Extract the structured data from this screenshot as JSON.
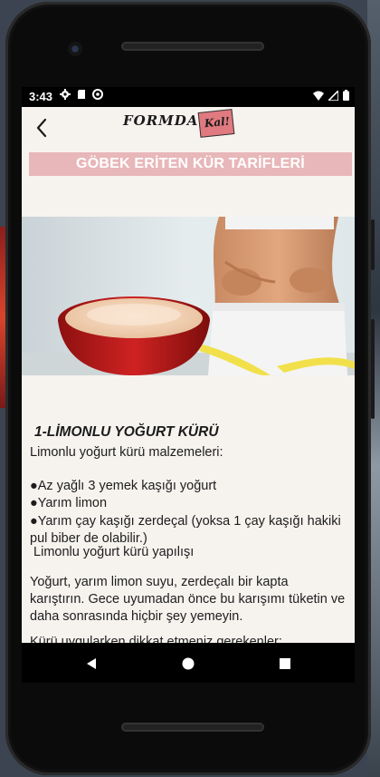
{
  "status_bar": {
    "time": "3:43",
    "left_icons": [
      "settings-icon",
      "sd-card-icon",
      "data-saver-icon"
    ],
    "right_icons": [
      "wifi-icon",
      "signal-icon",
      "battery-icon"
    ]
  },
  "app_bar": {
    "back_icon": "chevron-left-icon",
    "logo_text_main": "FORMDA",
    "logo_text_badge": "Kal!"
  },
  "page": {
    "title": "GÖBEK ERİTEN KÜR TARİFLERİ",
    "hero_image": "yogurt-bowl-and-waist-measuring-tape-image",
    "section_heading": "1-LİMONLU YOĞURT KÜRÜ",
    "ingredients_title": "Limonlu yoğurt kürü malzemeleri:",
    "ingredients": [
      "●Az yağlı 3 yemek kaşığı yoğurt",
      "●Yarım limon",
      "●Yarım çay kaşığı zerdeçal (yoksa 1 çay kaşığı hakiki pul biber de olabilir.)"
    ],
    "preparation_title": " Limonlu yoğurt kürü yapılışı",
    "preparation_text": "Yoğurt, yarım limon suyu, zerdeçalı bir kapta karıştırın. Gece uyumadan önce bu karışımı tüketin ve daha sonrasında hiçbir şey yemeyin.",
    "partial_text": "Kürü uygularken dikkat etmeniz gerekenler:"
  },
  "nav_bar": {
    "back_icon": "triangle-back-icon",
    "home_icon": "circle-home-icon",
    "recents_icon": "square-recents-icon"
  },
  "colors": {
    "title_band": "#e8b7b9",
    "screen_bg": "#f6f3ef",
    "logo_badge": "#e07a80"
  }
}
